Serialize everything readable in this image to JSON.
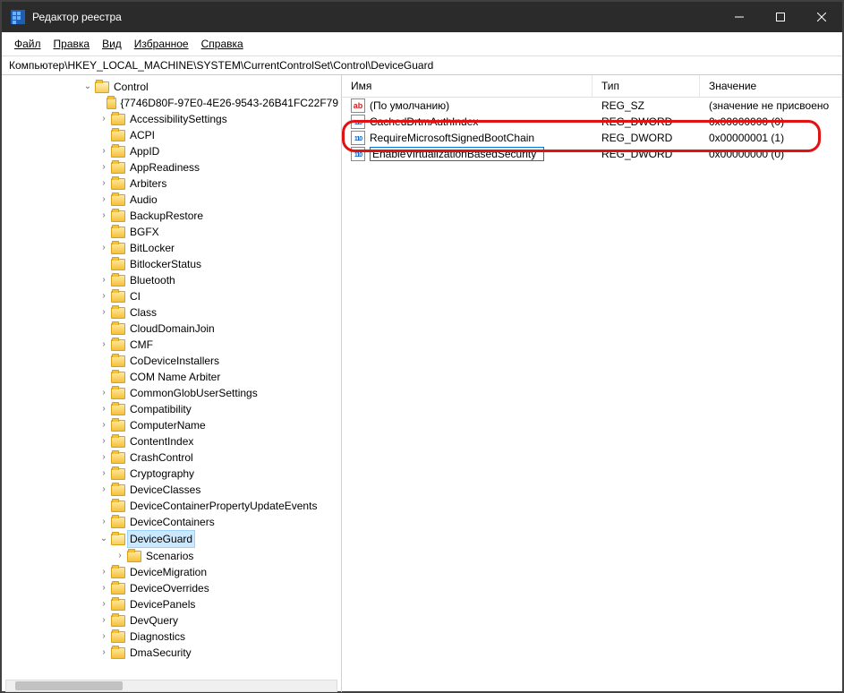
{
  "window": {
    "title": "Редактор реестра"
  },
  "menu": {
    "file": "Файл",
    "edit": "Правка",
    "view": "Вид",
    "favorites": "Избранное",
    "help": "Справка"
  },
  "address_bar": "Компьютер\\HKEY_LOCAL_MACHINE\\SYSTEM\\CurrentControlSet\\Control\\DeviceGuard",
  "tree": {
    "root_label": "Control",
    "items": [
      {
        "chev": "none",
        "label": "{7746D80F-97E0-4E26-9543-26B41FC22F79"
      },
      {
        "chev": "closed",
        "label": "AccessibilitySettings"
      },
      {
        "chev": "none",
        "label": "ACPI"
      },
      {
        "chev": "closed",
        "label": "AppID"
      },
      {
        "chev": "closed",
        "label": "AppReadiness"
      },
      {
        "chev": "closed",
        "label": "Arbiters"
      },
      {
        "chev": "closed",
        "label": "Audio"
      },
      {
        "chev": "closed",
        "label": "BackupRestore"
      },
      {
        "chev": "none",
        "label": "BGFX"
      },
      {
        "chev": "closed",
        "label": "BitLocker"
      },
      {
        "chev": "none",
        "label": "BitlockerStatus"
      },
      {
        "chev": "closed",
        "label": "Bluetooth"
      },
      {
        "chev": "closed",
        "label": "CI"
      },
      {
        "chev": "closed",
        "label": "Class"
      },
      {
        "chev": "none",
        "label": "CloudDomainJoin"
      },
      {
        "chev": "closed",
        "label": "CMF"
      },
      {
        "chev": "none",
        "label": "CoDeviceInstallers"
      },
      {
        "chev": "none",
        "label": "COM Name Arbiter"
      },
      {
        "chev": "closed",
        "label": "CommonGlobUserSettings"
      },
      {
        "chev": "closed",
        "label": "Compatibility"
      },
      {
        "chev": "closed",
        "label": "ComputerName"
      },
      {
        "chev": "closed",
        "label": "ContentIndex"
      },
      {
        "chev": "closed",
        "label": "CrashControl"
      },
      {
        "chev": "closed",
        "label": "Cryptography"
      },
      {
        "chev": "closed",
        "label": "DeviceClasses"
      },
      {
        "chev": "none",
        "label": "DeviceContainerPropertyUpdateEvents"
      },
      {
        "chev": "closed",
        "label": "DeviceContainers"
      },
      {
        "chev": "open",
        "label": "DeviceGuard",
        "selected": true,
        "children": [
          {
            "chev": "closed",
            "label": "Scenarios"
          }
        ]
      },
      {
        "chev": "closed",
        "label": "DeviceMigration"
      },
      {
        "chev": "closed",
        "label": "DeviceOverrides"
      },
      {
        "chev": "closed",
        "label": "DevicePanels"
      },
      {
        "chev": "closed",
        "label": "DevQuery"
      },
      {
        "chev": "closed",
        "label": "Diagnostics"
      },
      {
        "chev": "closed",
        "label": "DmaSecurity"
      }
    ]
  },
  "list": {
    "columns": {
      "name": "Имя",
      "type": "Тип",
      "value": "Значение"
    },
    "rows": [
      {
        "icon": "str",
        "name": "(По умолчанию)",
        "type": "REG_SZ",
        "value": "(значение не присвоено"
      },
      {
        "icon": "num",
        "name": "CachedDrtmAuthIndex",
        "type": "REG_DWORD",
        "value": "0x00000000 (0)"
      },
      {
        "icon": "num",
        "name": "RequireMicrosoftSignedBootChain",
        "type": "REG_DWORD",
        "value": "0x00000001 (1)"
      },
      {
        "icon": "num",
        "name": "EnableVirtualizationBasedSecurity",
        "type": "REG_DWORD",
        "value": "0x00000000 (0)",
        "editing": true
      }
    ]
  }
}
